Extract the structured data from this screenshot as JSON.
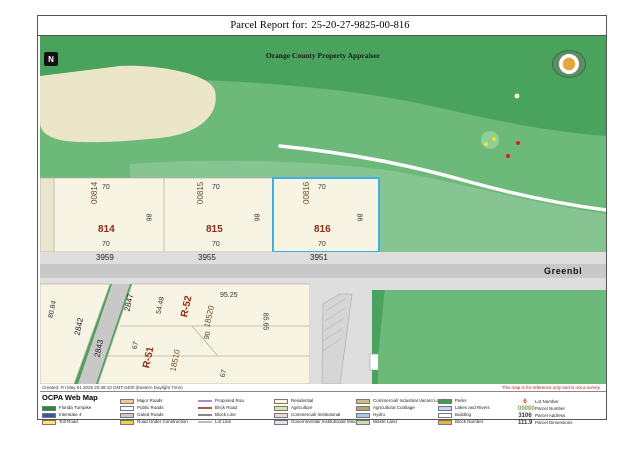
{
  "report": {
    "title_prefix": "Parcel Report for:",
    "parcel_id": "25-20-27-9825-00-816"
  },
  "map": {
    "appraiser": "Orange County Property Appraiser",
    "north_symbol": "N",
    "parcels": [
      {
        "id": "00814",
        "lot": "814",
        "dim_top": "70",
        "dim_bottom": "70",
        "dim_side": "86",
        "address": "3959"
      },
      {
        "id": "00815",
        "lot": "815",
        "dim_top": "70",
        "dim_bottom": "70",
        "dim_side": "86",
        "address": "3955"
      },
      {
        "id": "00816",
        "lot": "816",
        "dim_top": "70",
        "dim_bottom": "70",
        "dim_side": "86",
        "address": "3951"
      }
    ],
    "street_name": "Greenbl",
    "south_labels": {
      "r52": "R-52",
      "r51": "R-51",
      "dim_9525": "95.25",
      "dim_5448": "54.48",
      "dim_18520": "18520",
      "dim_8565": "85.65",
      "dim_90": "90",
      "dim_67a": "67",
      "dim_67b": "67",
      "dim_18510": "18510",
      "addr_2847": "2847",
      "addr_2842": "2842",
      "addr_2843": "2843",
      "dim_84": "80.84"
    },
    "colors": {
      "green_dark": "#4aa35c",
      "green_light": "#7ec48a",
      "sand": "#ece6c8",
      "parcel_fill": "#f7f4e4",
      "road": "#c8c8c8",
      "selected_outline": "#3fb0e0"
    }
  },
  "footer": {
    "created": "Created: Fri May 01 2026 20:38:10 GMT-0400 (Eastern Daylight Time)",
    "disclaimer": "This map is for reference only and is not a survey"
  },
  "legend": {
    "title": "OCPA Web Map",
    "items": [
      {
        "label": "Florida Turnpike",
        "swatch": "#1f8a3a",
        "kind": "box"
      },
      {
        "label": "Interstate 4",
        "swatch": "#3457a8",
        "kind": "box"
      },
      {
        "label": "Toll Road",
        "swatch": "#ffe36b",
        "kind": "box"
      },
      {
        "label": "Major Roads",
        "swatch": "#f5c98a",
        "kind": "box"
      },
      {
        "label": "Public Roads",
        "swatch": "#ffffff",
        "kind": "box"
      },
      {
        "label": "Gated Roads",
        "swatch": "#cccccc",
        "kind": "box"
      },
      {
        "label": "Road Under Construction",
        "swatch": "#f2d23a",
        "kind": "box"
      },
      {
        "label": "Proposed Roa",
        "swatch": "#b08bc8",
        "kind": "line"
      },
      {
        "label": "Brick Road",
        "swatch": "#b4584a",
        "kind": "line"
      },
      {
        "label": "Block Line",
        "swatch": "#888888",
        "kind": "line"
      },
      {
        "label": "Lot Line",
        "swatch": "#bbbbbb",
        "kind": "line"
      },
      {
        "label": "Residential",
        "swatch": "#fbf6dc",
        "kind": "box"
      },
      {
        "label": "Agriculture",
        "swatch": "#d8e6a0",
        "kind": "box"
      },
      {
        "label": "Commercial/ Institutional",
        "swatch": "#f1d9d9",
        "kind": "box"
      },
      {
        "label": "Governmental/ Institutional/ Misc",
        "swatch": "#e2e2f0",
        "kind": "box"
      },
      {
        "label": "Commercial/ Industrial Vacant Land",
        "swatch": "#c9bd86",
        "kind": "box"
      },
      {
        "label": "Agricultural Curtilage",
        "swatch": "#b7a76a",
        "kind": "box"
      },
      {
        "label": "Hydro",
        "swatch": "#a8c8ef",
        "kind": "box"
      },
      {
        "label": "Waste Land",
        "swatch": "#c8dfb8",
        "kind": "box"
      },
      {
        "label": "Parks",
        "swatch": "#3aa04a",
        "kind": "box"
      },
      {
        "label": "Lakes and Rivers",
        "swatch": "#bcd8ef",
        "kind": "box"
      },
      {
        "label": "Building",
        "swatch": "#ffffff",
        "kind": "box"
      },
      {
        "label": "Block Number",
        "swatch": "#e8b43a",
        "kind": "box"
      },
      {
        "label": "Lot Number",
        "sample": "6",
        "color": "#c0401a",
        "kind": "num"
      },
      {
        "label": "Parcel Number",
        "sample": "00000",
        "color": "#7fa24a",
        "kind": "num"
      },
      {
        "label": "Parcel Address",
        "sample": "3106",
        "color": "#333333",
        "kind": "num"
      },
      {
        "label": "Parcel Dimensions",
        "sample": "111.9",
        "color": "#333333",
        "kind": "num"
      }
    ]
  }
}
